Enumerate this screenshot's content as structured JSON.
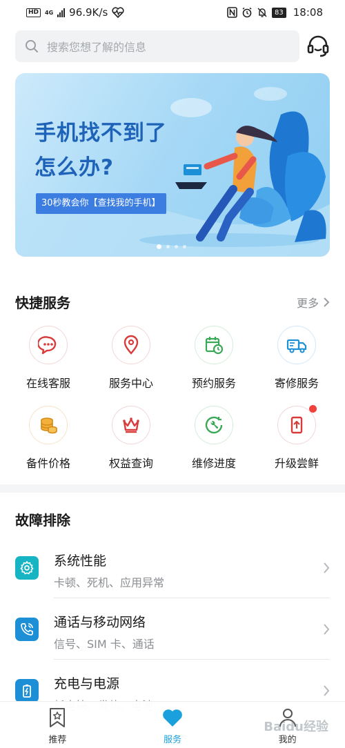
{
  "status_bar": {
    "network_badge": "HD",
    "net_type": "4G",
    "speed": "96.9K/s",
    "battery": "83",
    "time": "18:08"
  },
  "search": {
    "placeholder": "搜索您想了解的信息"
  },
  "banner": {
    "title_line1": "手机找不到了",
    "title_line2": "怎么办?",
    "button_label": "30秒教会你【查找我的手机】",
    "slide_count": 4,
    "active_slide": 1
  },
  "quick_services": {
    "title": "快捷服务",
    "more_label": "更多",
    "items": [
      {
        "label": "在线客服",
        "icon": "chat-bubble-icon",
        "color": "#d93b3b"
      },
      {
        "label": "服务中心",
        "icon": "location-pin-icon",
        "color": "#d93b3b"
      },
      {
        "label": "预约服务",
        "icon": "calendar-clock-icon",
        "color": "#3aa856"
      },
      {
        "label": "寄修服务",
        "icon": "truck-icon",
        "color": "#1d8fd6"
      },
      {
        "label": "备件价格",
        "icon": "coins-icon",
        "color": "#e39b22"
      },
      {
        "label": "权益查询",
        "icon": "crown-icon",
        "color": "#d93b3b"
      },
      {
        "label": "维修进度",
        "icon": "wrench-cycle-icon",
        "color": "#3aa856"
      },
      {
        "label": "升级尝鲜",
        "icon": "phone-upgrade-icon",
        "color": "#d93b3b",
        "badge": true
      }
    ]
  },
  "troubleshooting": {
    "title": "故障排除",
    "items": [
      {
        "title": "系统性能",
        "subtitle": "卡顿、死机、应用异常",
        "icon": "gear-icon",
        "color": "#17b5c4"
      },
      {
        "title": "通话与移动网络",
        "subtitle": "信号、SIM 卡、通话",
        "icon": "phone-call-icon",
        "color": "#1d8fd6"
      },
      {
        "title": "充电与电源",
        "subtitle": "耗电快、发热、电池",
        "icon": "battery-icon",
        "color": "#1d8fd6"
      }
    ]
  },
  "bottom_nav": {
    "items": [
      {
        "label": "推荐",
        "icon": "bookmark-star-icon"
      },
      {
        "label": "服务",
        "icon": "heart-icon",
        "active": true
      },
      {
        "label": "我的",
        "icon": "person-icon"
      }
    ],
    "active_color": "#1aa0dc"
  },
  "watermark": "Baidu经验"
}
